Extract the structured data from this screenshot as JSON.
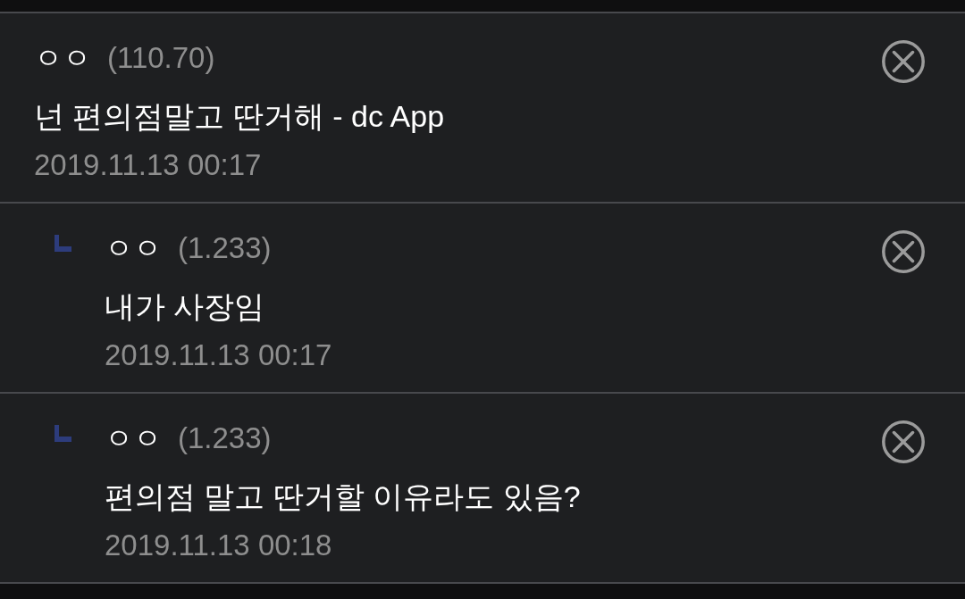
{
  "comments": [
    {
      "author": "ㅇㅇ",
      "ip": "(110.70)",
      "text": "넌 편의점말고 딴거해 - dc App",
      "time": "2019.11.13 00:17",
      "children": [
        {
          "author": "ㅇㅇ",
          "ip": "(1.233)",
          "text": "내가 사장임",
          "time": "2019.11.13 00:17"
        },
        {
          "author": "ㅇㅇ",
          "ip": "(1.233)",
          "text": "편의점 말고 딴거할 이유라도 있음?",
          "time": "2019.11.13 00:18"
        }
      ]
    }
  ]
}
